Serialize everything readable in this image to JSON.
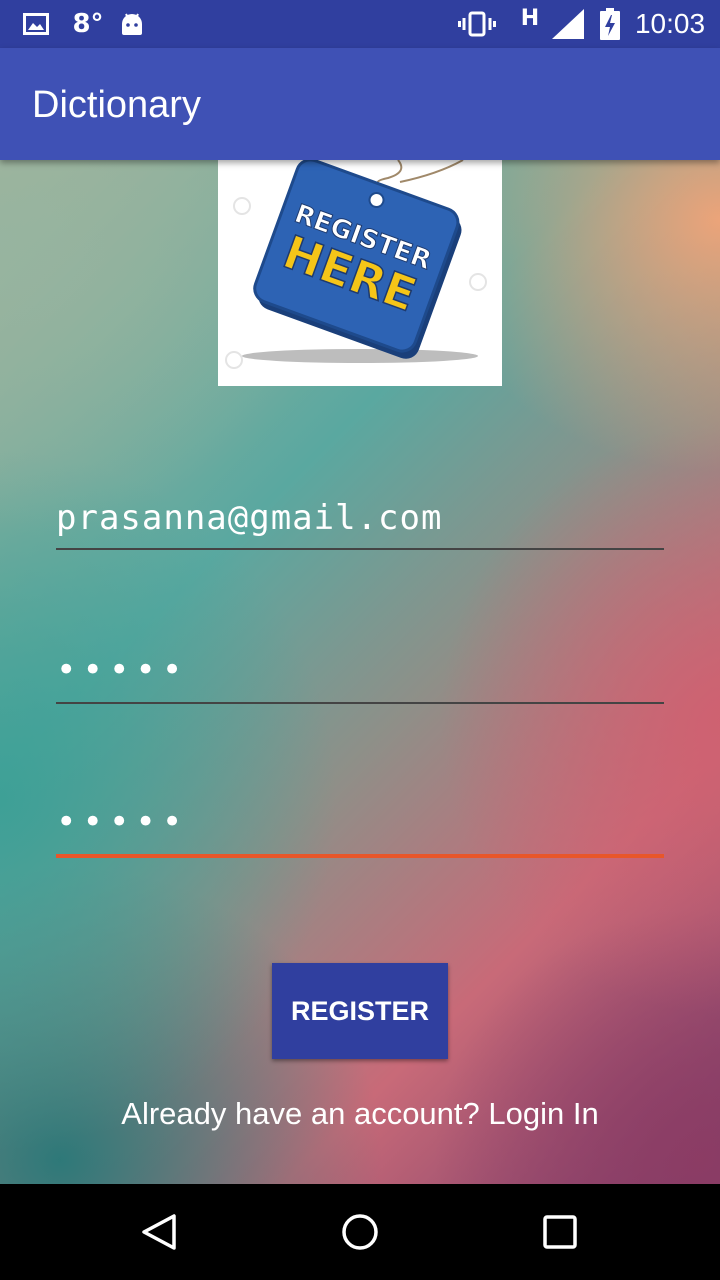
{
  "status_bar": {
    "temperature": "8°",
    "network_label": "H",
    "time": "10:03",
    "icons": [
      "gallery-icon",
      "android-icon",
      "vibrate-icon",
      "signal-icon",
      "battery-charging-icon"
    ]
  },
  "app_bar": {
    "title": "Dictionary"
  },
  "logo": {
    "line1": "REGISTER",
    "line2": "HERE"
  },
  "form": {
    "email_value": "prasanna@gmail.com",
    "password_value": "•••••",
    "confirm_password_value": "•••••",
    "accent_color": "#E8562A"
  },
  "register_button": {
    "label": "REGISTER",
    "color": "#303F9F"
  },
  "login_link": {
    "text": "Already have an account? Login In"
  },
  "nav_bar": {
    "icons": [
      "back-icon",
      "home-icon",
      "recents-icon"
    ]
  },
  "colors": {
    "primary": "#3F51B5",
    "primary_dark": "#303F9F"
  }
}
